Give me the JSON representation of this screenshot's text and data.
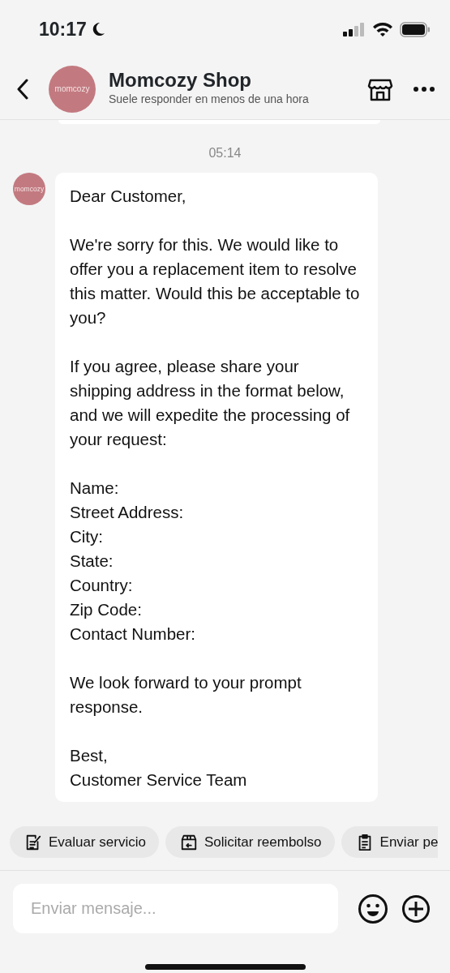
{
  "status_bar": {
    "time": "10:17"
  },
  "header": {
    "shop_name": "Momcozy Shop",
    "subtitle": "Suele responder en menos de una hora",
    "avatar_text": "momcozy"
  },
  "messages": [
    {
      "timestamp": "05:14",
      "avatar_text": "momcozy",
      "paragraphs": [
        "Dear Customer,",
        "We're sorry for this. We would like to offer you a replacement item to resolve this matter. Would this be acceptable to you?",
        "If you agree, please share your shipping address in the format below, and we will expedite the processing of your request:",
        "Name:\nStreet Address:\nCity:\nState:\nCountry:\nZip Code:\nContact Number:",
        "We look forward to your prompt response.",
        "Best,\nCustomer Service Team"
      ]
    }
  ],
  "quick_actions": [
    {
      "kind": "review",
      "label": "Evaluar servicio"
    },
    {
      "kind": "refund",
      "label": "Solicitar reembolso"
    },
    {
      "kind": "order",
      "label": "Enviar pe"
    }
  ],
  "composer": {
    "placeholder": "Enviar mensaje..."
  }
}
